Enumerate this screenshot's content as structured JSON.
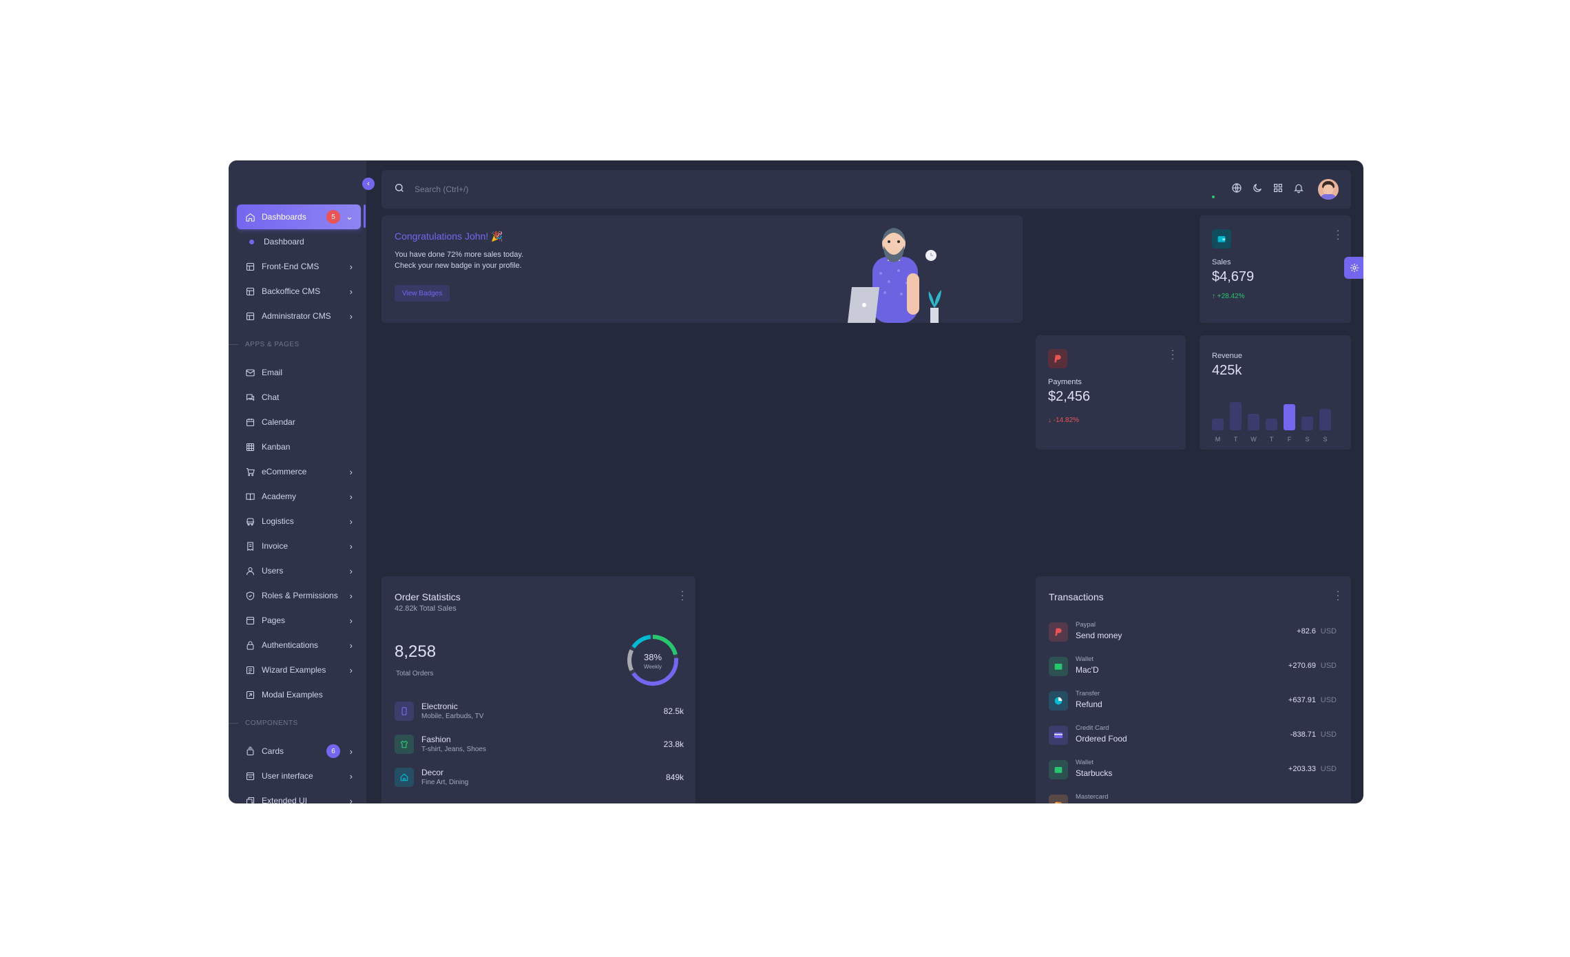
{
  "sidebar": {
    "dashboards": {
      "label": "Dashboards",
      "badge": "5"
    },
    "dashboard_sub": "Dashboard",
    "items_top": [
      {
        "label": "Front-End CMS"
      },
      {
        "label": "Backoffice CMS"
      },
      {
        "label": "Administrator CMS"
      }
    ],
    "section_apps": "APPS & PAGES",
    "apps": [
      {
        "label": "Email"
      },
      {
        "label": "Chat"
      },
      {
        "label": "Calendar"
      },
      {
        "label": "Kanban"
      },
      {
        "label": "eCommerce"
      },
      {
        "label": "Academy"
      },
      {
        "label": "Logistics"
      },
      {
        "label": "Invoice"
      },
      {
        "label": "Users"
      },
      {
        "label": "Roles & Permissions"
      },
      {
        "label": "Pages"
      },
      {
        "label": "Authentications"
      },
      {
        "label": "Wizard Examples"
      },
      {
        "label": "Modal Examples"
      }
    ],
    "section_components": "COMPONENTS",
    "components": [
      {
        "label": "Cards",
        "badge": "6"
      },
      {
        "label": "User interface"
      },
      {
        "label": "Extended UI"
      }
    ]
  },
  "navbar": {
    "search_placeholder": "Search (Ctrl+/)",
    "icons": [
      "globe-icon",
      "moon-icon",
      "grid-icon",
      "bell-icon"
    ]
  },
  "congrats": {
    "title": "Congratulations John! 🎉",
    "line1": "You have done 72% more sales today.",
    "line2": "Check your new badge in your profile.",
    "button": "View Badges"
  },
  "sales": {
    "label": "Sales",
    "value": "$4,679",
    "change": "+28.42%"
  },
  "payments": {
    "label": "Payments",
    "value": "$2,456",
    "change": "-14.82%"
  },
  "revenue": {
    "label": "Revenue",
    "value": "425k",
    "days": [
      "M",
      "T",
      "W",
      "T",
      "F",
      "S",
      "S"
    ],
    "bar_levels": [
      0.35,
      0.85,
      0.5,
      0.35,
      0.8,
      0.42,
      0.65
    ],
    "highlight_index": 4
  },
  "order_statistics": {
    "title": "Order Statistics",
    "subtitle": "42.82k Total Sales",
    "total": "8,258",
    "total_label": "Total Orders",
    "donut_pct": "38%",
    "donut_label": "Weekly",
    "rows": [
      {
        "name": "Electronic",
        "desc": "Mobile, Earbuds, TV",
        "value": "82.5k",
        "icon": "mobile-icon",
        "color": "#7367f0"
      },
      {
        "name": "Fashion",
        "desc": "T-shirt, Jeans, Shoes",
        "value": "23.8k",
        "icon": "shirt-icon",
        "color": "#28c76f"
      },
      {
        "name": "Decor",
        "desc": "Fine Art, Dining",
        "value": "849k",
        "icon": "home-icon",
        "color": "#00bad1"
      }
    ]
  },
  "transactions": {
    "title": "Transactions",
    "rows": [
      {
        "type": "Paypal",
        "name": "Send money",
        "amount": "+82.6",
        "currency": "USD",
        "icon": "paypal-icon",
        "color": "#ea5455"
      },
      {
        "type": "Wallet",
        "name": "Mac'D",
        "amount": "+270.69",
        "currency": "USD",
        "icon": "wallet-icon",
        "color": "#28c76f"
      },
      {
        "type": "Transfer",
        "name": "Refund",
        "amount": "+637.91",
        "currency": "USD",
        "icon": "chart-icon",
        "color": "#00bad1"
      },
      {
        "type": "Credit Card",
        "name": "Ordered Food",
        "amount": "-838.71",
        "currency": "USD",
        "icon": "credit-card-icon",
        "color": "#7367f0"
      },
      {
        "type": "Wallet",
        "name": "Starbucks",
        "amount": "+203.33",
        "currency": "USD",
        "icon": "wallet-icon",
        "color": "#28c76f"
      },
      {
        "type": "Mastercard",
        "name": "",
        "amount": "",
        "currency": "",
        "icon": "mastercard-icon",
        "color": "#ff9f43"
      }
    ]
  },
  "colors": {
    "primary": "#7367f0",
    "success": "#28c76f",
    "danger": "#ea5455",
    "info": "#00bad1",
    "bg": "#25293c",
    "card": "#2f3349"
  }
}
